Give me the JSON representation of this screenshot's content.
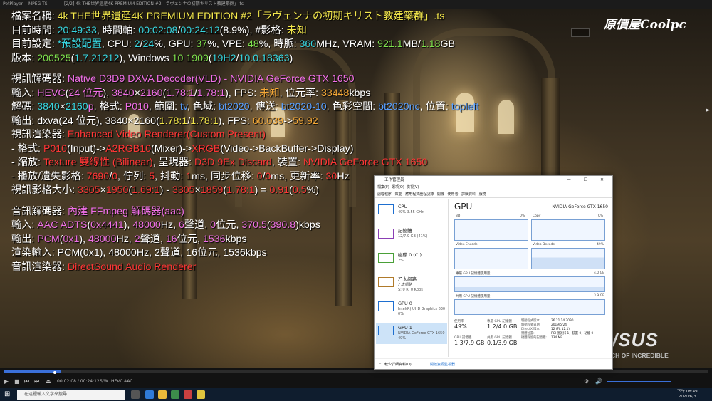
{
  "player": {
    "title": "PotPlayer",
    "format": "MPEG TS",
    "file_title": "[2/2] 4k THE世界遺産4K PREMIUM EDITION #2「ラヴェンナの初期キリスト教建築群」.ts"
  },
  "logo": "原價屋Coolpc",
  "osd": {
    "l1": [
      "檔案名稱: ",
      "4k THE世界遺産4K PREMIUM EDITION #2「ラヴェンナの初期キリスト教建築群」.ts"
    ],
    "l2": [
      "目前時間: ",
      "20:49:33",
      ", 時間軸: ",
      "00:02:08",
      "/",
      "00:24:12",
      "(8.9%)",
      ", #影格: ",
      "未知"
    ],
    "l3": [
      "目前設定: ",
      "*預設配置",
      ", CPU: ",
      "2",
      "/",
      "24",
      "%, GPU: ",
      "37",
      "%, VPE: ",
      "48",
      "%, 時脈: ",
      "360",
      "MHz, VRAM: ",
      "921.1",
      "MB/",
      "1.18",
      "GB"
    ],
    "l4": [
      "版本: ",
      "200525",
      "(",
      "1.7.21212",
      "), Windows ",
      "10 1909",
      "(",
      "19H2",
      "/",
      "10.0.18363",
      ")"
    ],
    "l5": [
      "視訊解碼器: ",
      "Native D3D9 DXVA Decoder(VLD) - NVIDIA GeForce GTX 1650"
    ],
    "l6": [
      "輸入: ",
      "HEVC",
      "(",
      "24 位元",
      "), ",
      "3840",
      "×",
      "2160",
      "(",
      "1.78:1",
      "/",
      "1.78:1",
      "), FPS: ",
      "未知",
      ", 位元率: ",
      "33448",
      "kbps"
    ],
    "l7": [
      "解碼: ",
      "3840",
      "×",
      "2160",
      "p",
      ", 格式: ",
      "P010",
      ", 範圍: ",
      "tv",
      ", 色域: ",
      "bt2020",
      ", 傳送: ",
      "bt2020-10",
      ", 色彩空間: ",
      "bt2020nc",
      ", 位置: ",
      "topleft"
    ],
    "l8": [
      "輸出: dxva(24 位元), 3840×2160(",
      "1.78:1",
      "/",
      "1.78:1",
      "), FPS: ",
      "60.039",
      "->",
      "59.92"
    ],
    "l9": [
      "視訊渲染器: ",
      "Enhanced Video Renderer(Custom Present)"
    ],
    "l10": [
      " - 格式: ",
      "P010",
      "(Input)->",
      "A2RGB10",
      "(Mixer)->",
      "XRGB",
      "(Video->BackBuffer->Display)"
    ],
    "l11": [
      " - 縮放: ",
      "Texture 雙線性 (Bilinear)",
      ", 呈現器: ",
      "D3D 9Ex Discard",
      ", 裝置: ",
      "NVIDIA GeForce GTX 1650"
    ],
    "l12": [
      " - 播放/遺失影格: ",
      "7690",
      "/",
      "0",
      ", 佇列: ",
      "5",
      ", 抖動: ",
      "1",
      "ms, 同步位移: ",
      "0",
      "/",
      "0",
      "ms, 更新率: ",
      "30",
      "Hz"
    ],
    "l13": [
      "視訊影格大小: ",
      "3305",
      "×",
      "1950",
      "(",
      "1.69:1",
      ") - ",
      "3305",
      "×",
      "1859",
      "(",
      "1.78:1",
      ") = ",
      "0.91",
      "(",
      "0.5",
      "%)"
    ],
    "l14": [
      "音訊解碼器: ",
      "內建 FFmpeg 解碼器(aac)"
    ],
    "l15": [
      "輸入: ",
      "AAC ADTS",
      "(",
      "0x4441",
      "), ",
      "48000",
      "Hz, ",
      "6",
      "聲道, ",
      "0",
      "位元, ",
      "370.5",
      "(",
      "390.8",
      ")kbps"
    ],
    "l16": [
      "輸出: ",
      "PCM",
      "(",
      "0x1",
      "), ",
      "48000",
      "Hz, ",
      "2",
      "聲道, ",
      "16",
      "位元, ",
      "1536",
      "kbps"
    ],
    "l17": [
      "渲染輸入: PCM(0x1), 48000Hz, 2聲道, 16位元, 1536kbps"
    ],
    "l18": [
      "音訊渲染器: ",
      "DirectSound Audio Renderer"
    ]
  },
  "brand": {
    "asus": "/SUS",
    "tagline": "CH OF INCREDIBLE"
  },
  "controls": {
    "time": "00:02:08 / 00:24:12",
    "badges": [
      "S/W",
      "HEVC",
      "AAC"
    ]
  },
  "taskbar": {
    "search_placeholder": "在這裡輸入文字來搜尋",
    "time": "下午 08:49",
    "date": "2020/6/3"
  },
  "taskmgr": {
    "title": "工作管理員",
    "menu": [
      "檔案(F)",
      "選項(O)",
      "檢視(V)"
    ],
    "tabs": [
      "處理程序",
      "效能",
      "應用程式歷程記錄",
      "開機",
      "使用者",
      "詳細資料",
      "服務"
    ],
    "side": [
      {
        "name": "CPU",
        "sub": "49% 3.55 GHz",
        "sub2": ""
      },
      {
        "name": "記憶體",
        "sub": "12/7.9 GB (41%)",
        "sub2": ""
      },
      {
        "name": "磁碟 0 (C:)",
        "sub": "2%",
        "sub2": ""
      },
      {
        "name": "乙太網路",
        "sub": "乙太網路",
        "sub2": "S: 0 R: 0 Kbps"
      },
      {
        "name": "GPU 0",
        "sub": "Intel(R) UHD Graphics 630",
        "sub2": "0%"
      },
      {
        "name": "GPU 1",
        "sub": "NVIDIA GeForce GTX 1650",
        "sub2": "49%"
      }
    ],
    "gpu_title": "GPU",
    "gpu_name": "NVIDIA GeForce GTX 1650",
    "graphs": {
      "g3d": "3D",
      "gcopy": "Copy",
      "gvenc": "Video Encode",
      "gvdec": "Video Decode",
      "pct_a": "0%",
      "pct_b": "0%",
      "pct_c": "49%",
      "dedicated": "專屬 GPU 記憶體使用量",
      "dedicated_max": "4.0 GB",
      "shared": "共用 GPU 記憶體使用量",
      "shared_max": "3.9 GB"
    },
    "stats": {
      "util_label": "使用率",
      "util": "49%",
      "ded_label": "專屬 GPU 記憶體",
      "ded": "1.2/4.0 GB",
      "gpumem_label": "GPU 記憶體",
      "gpumem": "1.3/7.9 GB",
      "shared_label": "共用 GPU 記憶體",
      "shared": "0.1/3.9 GB"
    },
    "details": [
      [
        "驅動程式版本:",
        "26.21.14.3090"
      ],
      [
        "驅動程式日期:",
        "2019/5/24"
      ],
      [
        "DirectX 版本:",
        "12 (FL 12.1)"
      ],
      [
        "實體位置:",
        "PCI 匯流排 1，裝置 0，功能 0"
      ],
      [
        "硬體保留的記憶體:",
        "134 MB"
      ]
    ],
    "footer": {
      "less": "較少詳細資料(D)",
      "monitor": "開啟資源監視器"
    },
    "controls": "— ☐ ✕"
  }
}
